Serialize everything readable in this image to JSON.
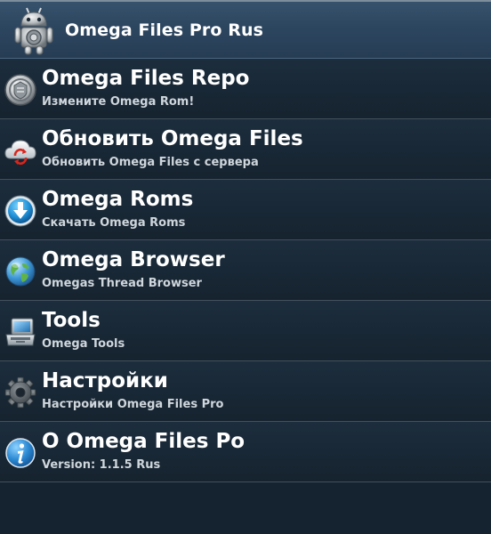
{
  "app_bar": {
    "title": "Omega Files Pro Rus",
    "icon": "android-robot-icon"
  },
  "menu": [
    {
      "icon": "shield-emblem-icon",
      "title": "Omega Files Repo",
      "subtitle": "Измените Omega Rom!"
    },
    {
      "icon": "cloud-sync-icon",
      "title": "Обновить Omega Files",
      "subtitle": "Обновить Omega Files с сервера"
    },
    {
      "icon": "download-icon",
      "title": "Omega Roms",
      "subtitle": "Скачать Omega Roms"
    },
    {
      "icon": "globe-icon",
      "title": "Omega Browser",
      "subtitle": "Omegas Thread Browser"
    },
    {
      "icon": "toolbox-icon",
      "title": "Tools",
      "subtitle": "Omega Tools"
    },
    {
      "icon": "gear-icon",
      "title": "Настройки",
      "subtitle": "Настройки Omega Files Pro"
    },
    {
      "icon": "info-icon",
      "title": "О Omega Files Po",
      "subtitle": "Version: 1.1.5 Rus"
    }
  ],
  "colors": {
    "app_bar": "#2d4660",
    "background": "#152230",
    "divider": "#42505c",
    "subtitle": "#cfd6dc"
  }
}
